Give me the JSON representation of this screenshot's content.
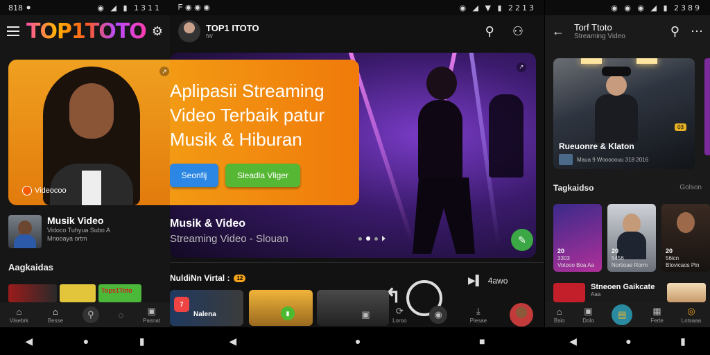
{
  "colors": {
    "accent_orange": "#f39a14",
    "accent_green": "#56b734",
    "accent_blue": "#2b86e4",
    "bg_dark": "#141414"
  },
  "screen1": {
    "status": {
      "time": "818 ⚫",
      "icons": "◉ ◢ ▮ 1311"
    },
    "logo": "TOP1TOTO",
    "hero_badge": "Videocoo",
    "row": {
      "title": "Musik Video",
      "sub1": "Vidoco Tuhyua Subo A",
      "sub2": "Mnooaya ortm"
    },
    "section": "Aagkaidas",
    "minicard_label": "Tops1Toto",
    "nav": [
      {
        "icon": "home-outline-icon",
        "glyph": "⌂",
        "label": "Vlaebrk"
      },
      {
        "icon": "home-icon",
        "glyph": "⌂",
        "label": "Besse"
      },
      {
        "icon": "search-icon",
        "glyph": "⚲",
        "label": ""
      },
      {
        "icon": "chat-icon",
        "glyph": "◌",
        "label": ""
      },
      {
        "icon": "library-icon",
        "glyph": "▣",
        "label": "Pasnat"
      }
    ]
  },
  "screen2": {
    "status": {
      "time": "ᖴ ◉ ◉ ◉",
      "icons": "◉ ◢ ▼ ▮ 2213"
    },
    "channel": {
      "name": "TOP1 ITOTO",
      "sub": "fW"
    },
    "promo": {
      "title": "Aplipasii Streaming Video Terbaik patur Musik & Hiburan",
      "btn_primary": "Seonfij",
      "btn_secondary": "Sleadla Vliger"
    },
    "caption": {
      "title": "Musik & Video",
      "sub": "Streaming Video - Slouan"
    },
    "section": "NuldiNn Virtal :",
    "section_badge": "12",
    "control_label": "4awo",
    "card_label": "Nalena",
    "nav": [
      {
        "icon": "library-icon",
        "glyph": "▣",
        "label": ""
      },
      {
        "icon": "refresh-icon",
        "glyph": "⟳",
        "label": "Loroo"
      },
      {
        "icon": "record-icon",
        "glyph": "◉",
        "label": ""
      },
      {
        "icon": "download-icon",
        "glyph": "⤓",
        "label": "Piesae"
      }
    ]
  },
  "screen3": {
    "status": {
      "time": "◉ ◉ ◉ ◢ ▮ 2389"
    },
    "header": {
      "title": "Torf Ttoto",
      "sub": "Streaming Video"
    },
    "hero": {
      "title": "Rueuonre & Klaton",
      "sub": "Maua 9 Wooooouu 318 2016",
      "tag": "03"
    },
    "section": "Tagkaidso",
    "section_action": "Golson",
    "tiles": [
      {
        "num": "20",
        "sub": "3303",
        "sub2": "Votooo Boa Aa"
      },
      {
        "num": "20",
        "sub": "5456",
        "sub2": "Nortioae Rorm"
      },
      {
        "num": "20",
        "sub": "56icn",
        "sub2": "Btovicaos Pin"
      }
    ],
    "row": {
      "title": "Stneoen Gaikcate",
      "sub": "Aaa"
    },
    "nav": [
      {
        "icon": "home-icon",
        "glyph": "⌂",
        "label": "Bsio"
      },
      {
        "icon": "library-icon",
        "glyph": "▣",
        "label": "Dolo"
      },
      {
        "icon": "lock-icon",
        "glyph": "▤",
        "label": ""
      },
      {
        "icon": "grid-icon",
        "glyph": "▦",
        "label": "Ferte"
      },
      {
        "icon": "profile-icon",
        "glyph": "◎",
        "label": "Lotsaaa"
      }
    ]
  }
}
